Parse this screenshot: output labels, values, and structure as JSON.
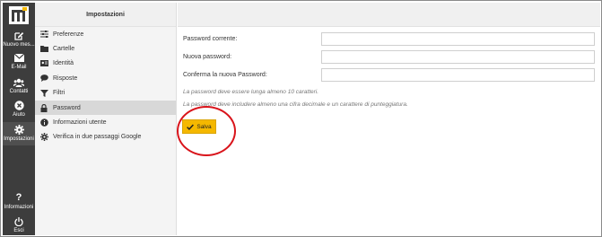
{
  "taskbar": {
    "logo_icon": "m-logo-icon",
    "items": [
      {
        "label": "Nuovo mes...",
        "icon": "compose-icon"
      },
      {
        "label": "E-Mail",
        "icon": "envelope-icon"
      },
      {
        "label": "Contatti",
        "icon": "contacts-icon"
      },
      {
        "label": "Aiuto",
        "icon": "help-circle-icon"
      },
      {
        "label": "Impostazioni",
        "icon": "gear-icon"
      },
      {
        "label": "Informazioni",
        "icon": "question-icon"
      },
      {
        "label": "Esci",
        "icon": "power-icon"
      }
    ]
  },
  "settings": {
    "header": "Impostazioni",
    "items": [
      {
        "label": "Preferenze",
        "icon": "sliders-icon"
      },
      {
        "label": "Cartelle",
        "icon": "folder-icon"
      },
      {
        "label": "Identità",
        "icon": "id-card-icon"
      },
      {
        "label": "Risposte",
        "icon": "comment-icon"
      },
      {
        "label": "Filtri",
        "icon": "filter-icon"
      },
      {
        "label": "Password",
        "icon": "lock-icon"
      },
      {
        "label": "Informazioni utente",
        "icon": "info-icon"
      },
      {
        "label": "Verifica in due passaggi Google",
        "icon": "gear-icon"
      }
    ],
    "selected": "Password"
  },
  "password_form": {
    "current_label": "Password corrente:",
    "current_value": "",
    "new_label": "Nuova password:",
    "new_value": "",
    "confirm_label": "Conferma la nuova Password:",
    "confirm_value": "",
    "hint_length": "La password deve essere lunga almeno 10 caratteri.",
    "hint_chars": "La password deve includere almeno una cifra decimale e un carattere di punteggiatura.",
    "save_label": "Salva"
  },
  "colors": {
    "taskbar_bg": "#3d3d3d",
    "accent_yellow": "#f5b800",
    "annotation_red": "#d9141b",
    "selected_row": "#d8d8d8"
  }
}
